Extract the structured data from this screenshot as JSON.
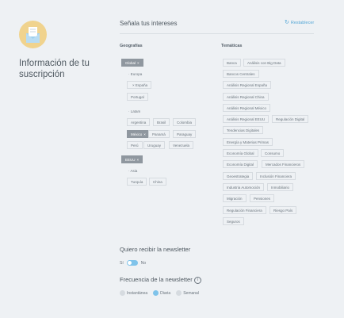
{
  "sidebar": {
    "title": "Información de tu suscripción"
  },
  "header": {
    "title": "Señala tus intereses",
    "reset_label": "Restablecer"
  },
  "geografias": {
    "title": "Geografías",
    "chips": [
      {
        "label": "Global",
        "selected": true
      },
      {
        "label": "Europa",
        "selected": false
      },
      {
        "label": "España",
        "selected": false,
        "removable": true
      },
      {
        "label": "Portugal",
        "selected": false
      },
      {
        "label": "Latam",
        "selected": false
      },
      {
        "label": "Argentina",
        "selected": false
      },
      {
        "label": "Brasil",
        "selected": false
      },
      {
        "label": "Colombia",
        "selected": false
      },
      {
        "label": "México",
        "selected": true
      },
      {
        "label": "Panamá",
        "selected": false
      },
      {
        "label": "Paraguay",
        "selected": false
      },
      {
        "label": "Perú",
        "selected": false
      },
      {
        "label": "Uruguay",
        "selected": false
      },
      {
        "label": "Venezuela",
        "selected": false
      },
      {
        "label": "EEUU",
        "selected": true
      },
      {
        "label": "Asia",
        "selected": false
      },
      {
        "label": "Turquía",
        "selected": false
      },
      {
        "label": "China",
        "selected": false
      }
    ]
  },
  "tematicas": {
    "title": "Temáticas",
    "chips": [
      {
        "label": "Banca"
      },
      {
        "label": "Análisis con Big Data"
      },
      {
        "label": "Bancos Centrales"
      },
      {
        "label": "Análisis Regional España"
      },
      {
        "label": "Análisis Regional China"
      },
      {
        "label": "Análisis Regional México"
      },
      {
        "label": "Análisis Regional EEUU"
      },
      {
        "label": "Regulación Digital"
      },
      {
        "label": "Tendencias Digitales"
      },
      {
        "label": "Energía y Materias Primas"
      },
      {
        "label": "Economía Global"
      },
      {
        "label": "Consumo"
      },
      {
        "label": "Economía Digital"
      },
      {
        "label": "Mercados Financieros"
      },
      {
        "label": "Geoestrategia"
      },
      {
        "label": "Inclusión Financiera"
      },
      {
        "label": "Industria Automoción"
      },
      {
        "label": "Inmobiliario"
      },
      {
        "label": "Migración"
      },
      {
        "label": "Pensiones"
      },
      {
        "label": "Regulación Financiera"
      },
      {
        "label": "Riesgo País"
      },
      {
        "label": "Seguros"
      }
    ]
  },
  "newsletter": {
    "title": "Quiero recibir la newsletter",
    "yes": "Sí",
    "no": "No",
    "enabled": true
  },
  "frecuencia": {
    "title": "Frecuencia de la newsletter",
    "info_icon": "info-icon",
    "options": [
      {
        "label": "Instantánea",
        "selected": false
      },
      {
        "label": "Diaria",
        "selected": true
      },
      {
        "label": "Semanal",
        "selected": false
      }
    ]
  },
  "colors": {
    "accent": "#7fc3ea",
    "link": "#55a7d6",
    "selected_chip": "#8f979f",
    "avatar_bg": "#f0d38e"
  }
}
